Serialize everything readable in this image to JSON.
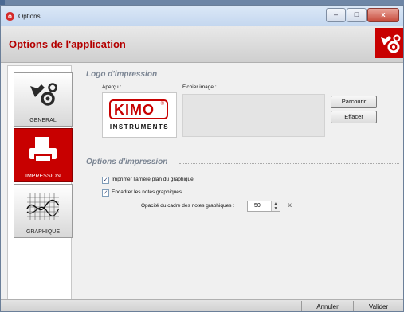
{
  "window": {
    "title": "Options",
    "close_glyph": "x",
    "minimize_glyph": "–",
    "maximize_glyph": "□"
  },
  "header": {
    "title": "Options de l'application",
    "icon": "gears-icon"
  },
  "sidebar": {
    "items": [
      {
        "label": "GENERAL",
        "icon": "gears-icon",
        "active": false
      },
      {
        "label": "IMPRESSION",
        "icon": "printer-icon",
        "active": true
      },
      {
        "label": "GRAPHIQUE",
        "icon": "graph-icon",
        "active": false
      }
    ]
  },
  "logo_section": {
    "title": "Logo d'impression",
    "preview_label": "Aperçu :",
    "file_label": "Fichier image :",
    "logo_top": "KIMO",
    "logo_registered": "®",
    "logo_bottom": "INSTRUMENTS",
    "browse_button": "Parcourir",
    "clear_button": "Effacer"
  },
  "print_section": {
    "title": "Options d'impression",
    "print_background": {
      "label": "Imprimer l'arrière plan du graphique",
      "checked": true
    },
    "frame_notes": {
      "label": "Encadrer les notes graphiques",
      "checked": true
    },
    "opacity": {
      "label": "Opacité du cadre des notes graphiques :",
      "value": "50",
      "unit": "%"
    }
  },
  "footer": {
    "cancel_button": "Annuler",
    "validate_button": "Valider"
  },
  "colors": {
    "accent": "#c80000",
    "title_red": "#b40000"
  }
}
